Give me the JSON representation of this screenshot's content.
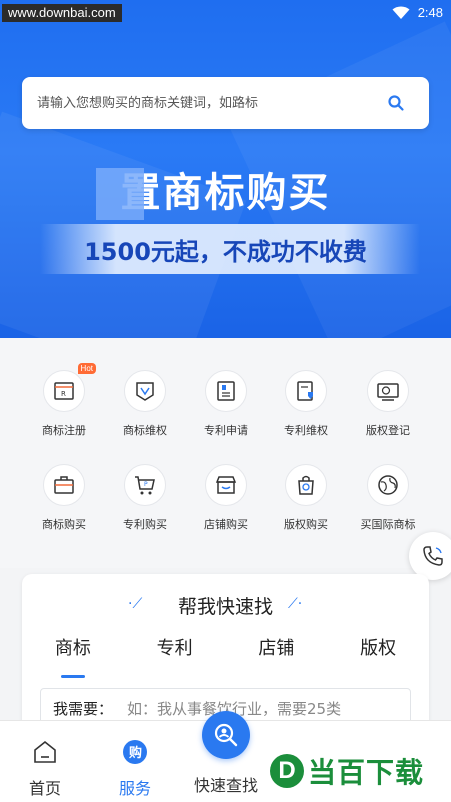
{
  "status_bar": {
    "watermark": "www.downbai.com",
    "time": "2:48"
  },
  "search": {
    "placeholder": "请输入您想购买的商标关键词，如路标"
  },
  "hero": {
    "title": "置商标购买",
    "subtitle": "1500元起，不成功不收费"
  },
  "services": [
    {
      "label": "商标注册",
      "icon": "trademark-register-icon",
      "badge": "Hot"
    },
    {
      "label": "商标维权",
      "icon": "trademark-protect-icon"
    },
    {
      "label": "专利申请",
      "icon": "patent-apply-icon"
    },
    {
      "label": "专利维权",
      "icon": "patent-protect-icon"
    },
    {
      "label": "版权登记",
      "icon": "copyright-register-icon"
    },
    {
      "label": "商标购买",
      "icon": "trademark-buy-icon"
    },
    {
      "label": "专利购买",
      "icon": "patent-buy-icon"
    },
    {
      "label": "店铺购买",
      "icon": "shop-buy-icon"
    },
    {
      "label": "版权购买",
      "icon": "copyright-buy-icon"
    },
    {
      "label": "买国际商标",
      "icon": "international-trademark-icon"
    }
  ],
  "quick_find": {
    "title": "帮我快速找",
    "tabs": [
      "商标",
      "专利",
      "店铺",
      "版权"
    ],
    "active_tab": "商标",
    "need_label": "我需要：",
    "need_placeholder": "如：我从事餐饮行业，需要25类"
  },
  "bottom_nav": {
    "items": [
      {
        "label": "首页",
        "icon": "home-icon"
      },
      {
        "label": "服务",
        "icon": "service-icon",
        "active": true
      },
      {
        "label": "快速查找",
        "icon": "quick-search-icon"
      }
    ],
    "logo_text": "当百下载",
    "logo_letter": "D"
  },
  "colors": {
    "primary": "#2a79f0",
    "hero": "#1f6ef0",
    "hot_badge": "#ff6b35",
    "logo_green": "#1b8e3b"
  }
}
